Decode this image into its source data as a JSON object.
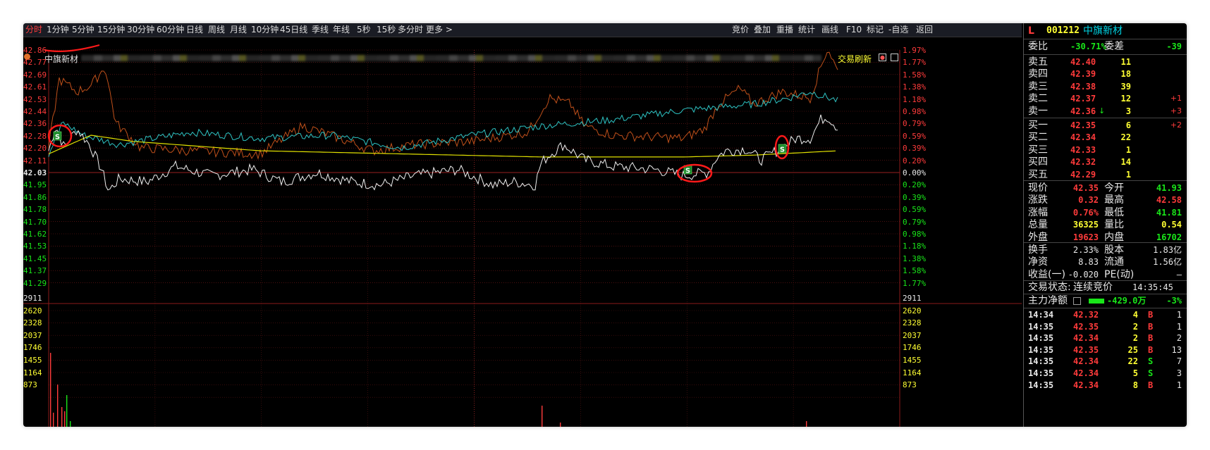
{
  "toolbar": {
    "periods": [
      "分时",
      "1分钟",
      "5分钟",
      "15分钟",
      "30分钟",
      "60分钟",
      "日线",
      "周线",
      "月线",
      "10分钟",
      "45日线",
      "季线",
      "年线",
      "5秒",
      "15秒",
      "多分时",
      "更多 >"
    ],
    "tools": [
      "竞价",
      "叠加",
      "重播",
      "统计",
      "画线",
      "F10",
      "标记",
      "-自选",
      "返回"
    ]
  },
  "chart_header": {
    "stock_name": "中旗新材",
    "refresh_label": "交易刷新"
  },
  "price_axis": {
    "left": [
      "42.86",
      "42.77",
      "42.69",
      "42.61",
      "42.53",
      "42.44",
      "42.36",
      "42.28",
      "42.20",
      "42.11",
      "42.03",
      "41.95",
      "41.86",
      "41.78",
      "41.70",
      "41.62",
      "41.53",
      "41.45",
      "41.37",
      "41.29"
    ],
    "right": [
      "1.97%",
      "1.77%",
      "1.58%",
      "1.38%",
      "1.18%",
      "0.98%",
      "0.79%",
      "0.59%",
      "0.39%",
      "0.20%",
      "0.00%",
      "0.20%",
      "0.39%",
      "0.59%",
      "0.79%",
      "0.98%",
      "1.18%",
      "1.38%",
      "1.58%",
      "1.77%"
    ]
  },
  "volume_axis": [
    "2911",
    "2620",
    "2328",
    "2037",
    "1746",
    "1455",
    "1164",
    "873"
  ],
  "markers": [
    "S",
    "S",
    "S"
  ],
  "quote": {
    "flag": "L",
    "code": "001212",
    "name": "中旗新材",
    "webi_label": "委比",
    "webi": "-30.71%",
    "weicha_label": "委差",
    "weicha": "-39",
    "asks": [
      {
        "label": "卖五",
        "price": "42.40",
        "vol": "11",
        "chg": ""
      },
      {
        "label": "卖四",
        "price": "42.39",
        "vol": "18",
        "chg": ""
      },
      {
        "label": "卖三",
        "price": "42.38",
        "vol": "39",
        "chg": ""
      },
      {
        "label": "卖二",
        "price": "42.37",
        "vol": "12",
        "chg": "+1"
      },
      {
        "label": "卖一",
        "price": "42.36",
        "vol": "3",
        "chg": "+3"
      }
    ],
    "bids": [
      {
        "label": "买一",
        "price": "42.35",
        "vol": "6",
        "chg": "+2"
      },
      {
        "label": "买二",
        "price": "42.34",
        "vol": "22",
        "chg": ""
      },
      {
        "label": "买三",
        "price": "42.33",
        "vol": "1",
        "chg": ""
      },
      {
        "label": "买四",
        "price": "42.32",
        "vol": "14",
        "chg": ""
      },
      {
        "label": "买五",
        "price": "42.29",
        "vol": "1",
        "chg": ""
      }
    ],
    "stats": [
      {
        "l1": "现价",
        "v1": "42.35",
        "c1": "r",
        "l2": "今开",
        "v2": "41.93",
        "c2": "g"
      },
      {
        "l1": "涨跌",
        "v1": "0.32",
        "c1": "r",
        "l2": "最高",
        "v2": "42.58",
        "c2": "r"
      },
      {
        "l1": "涨幅",
        "v1": "0.76%",
        "c1": "r",
        "l2": "最低",
        "v2": "41.81",
        "c2": "g"
      },
      {
        "l1": "总量",
        "v1": "36325",
        "c1": "y",
        "l2": "量比",
        "v2": "0.54",
        "c2": "y"
      },
      {
        "l1": "外盘",
        "v1": "19623",
        "c1": "r",
        "l2": "内盘",
        "v2": "16702",
        "c2": "g"
      }
    ],
    "fund": [
      {
        "l1": "换手",
        "v1": "2.33%",
        "l2": "股本",
        "v2": "1.83亿"
      },
      {
        "l1": "净资",
        "v1": "8.83",
        "l2": "流通",
        "v2": "1.56亿"
      },
      {
        "l1": "收益(一)",
        "v1": "-0.020",
        "l2": "PE(动)",
        "v2": "–"
      }
    ],
    "status_label": "交易状态:",
    "status": "连续竞价",
    "status_time": "14:35:45",
    "main_flow_label": "主力净额",
    "main_flow": "-429.0万",
    "main_flow_pct": "-3%"
  },
  "ticks": [
    {
      "time": "14:34",
      "price": "42.32",
      "vol": "4",
      "side": "B",
      "n": "1"
    },
    {
      "time": "14:35",
      "price": "42.35",
      "vol": "2",
      "side": "B",
      "n": "1"
    },
    {
      "time": "14:35",
      "price": "42.34",
      "vol": "2",
      "side": "B",
      "n": "2"
    },
    {
      "time": "14:35",
      "price": "42.35",
      "vol": "25",
      "side": "B",
      "n": "13"
    },
    {
      "time": "14:35",
      "price": "42.34",
      "vol": "22",
      "side": "S",
      "n": "7"
    },
    {
      "time": "14:35",
      "price": "42.34",
      "vol": "5",
      "side": "S",
      "n": "3"
    },
    {
      "time": "14:35",
      "price": "42.34",
      "vol": "8",
      "side": "B",
      "n": "1"
    }
  ],
  "colors": {
    "up": "#ff3b3b",
    "down": "#19e619",
    "neutral": "#e8e8e8",
    "volume": "#ffff33",
    "code": "#ffff33",
    "name": "#00d5e5",
    "avg_line": "#e0e000",
    "overlay1": "#2ec4c4",
    "overlay2": "#c0501a"
  }
}
